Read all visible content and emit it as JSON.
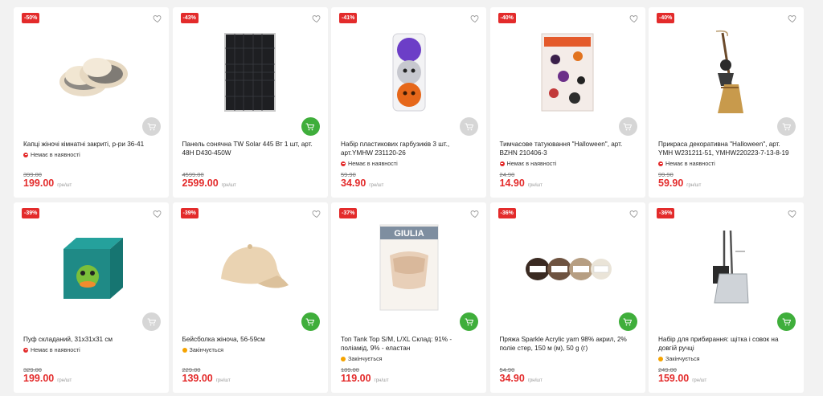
{
  "colors": {
    "badge": "#e32b2b",
    "price": "#e32b2b",
    "cart_active": "#3fae3b",
    "cart_inactive": "#d6d6d6",
    "status_out": "#e32b2b",
    "status_ending": "#f5a300"
  },
  "products": [
    {
      "badge": "-50%",
      "title": "Капці жіночі кімнатні закриті, р-ри 36-41",
      "status": "Немає в наявності",
      "status_type": "out",
      "old_price": "399.00",
      "price": "199.00",
      "currency": "грн/шт",
      "cart_active": false,
      "image": "slippers-image"
    },
    {
      "badge": "-43%",
      "title": "Панель сонячна TW Solar 445 Вт 1 шт, арт. 48H D430-450W",
      "status": "",
      "status_type": "none",
      "old_price": "4599.00",
      "price": "2599.00",
      "currency": "грн/шт",
      "cart_active": true,
      "image": "solar-panel-image"
    },
    {
      "badge": "-41%",
      "title": "Набір пластикових гарбузиків 3 шт., арт.YMHW 231120-26",
      "status": "Немає в наявності",
      "status_type": "out",
      "old_price": "59.90",
      "price": "34.90",
      "currency": "грн/шт",
      "cart_active": false,
      "image": "pumpkins-image"
    },
    {
      "badge": "-40%",
      "title": "Тимчасове татуювання \"Halloween\", арт. BZHN 210406-3",
      "status": "Немає в наявності",
      "status_type": "out",
      "old_price": "24.90",
      "price": "14.90",
      "currency": "грн/шт",
      "cart_active": false,
      "image": "tattoo-image"
    },
    {
      "badge": "-40%",
      "title": "Прикраса декоративна \"Halloween\", арт. YMH W231211-51, YMHW220223-7-13-8-19",
      "status": "Немає в наявності",
      "status_type": "out",
      "old_price": "99.90",
      "price": "59.90",
      "currency": "грн/шт",
      "cart_active": false,
      "image": "witch-broom-image"
    },
    {
      "badge": "-39%",
      "title": "Пуф складаний, 31х31х31 см",
      "status": "Немає в наявності",
      "status_type": "out",
      "old_price": "329.00",
      "price": "199.00",
      "currency": "грн/шт",
      "cart_active": false,
      "image": "pouf-image"
    },
    {
      "badge": "-39%",
      "title": "Бейсболка жіноча, 56-59см",
      "status": "Закінчується",
      "status_type": "ending",
      "old_price": "229.00",
      "price": "139.00",
      "currency": "грн/шт",
      "cart_active": true,
      "image": "cap-image"
    },
    {
      "badge": "-37%",
      "title": "Топ Tank Top S/M, L/XL Склад: 91% - поліамід, 9% - еластан",
      "status": "Закінчується",
      "status_type": "ending",
      "old_price": "189.00",
      "price": "119.00",
      "currency": "грн/шт",
      "cart_active": true,
      "image": "tank-top-image",
      "brand_text": "GIULIA"
    },
    {
      "badge": "-36%",
      "title": "Пряжа Sparkle Acrylic yarn 98% акрил, 2% поліе стер, 150 м (м), 50 g (г)",
      "status": "",
      "status_type": "none",
      "old_price": "54.90",
      "price": "34.90",
      "currency": "грн/шт",
      "cart_active": true,
      "image": "yarn-image"
    },
    {
      "badge": "-36%",
      "title": "Набір для прибирання: щітка і совок на довгій ручці",
      "status": "Закінчується",
      "status_type": "ending",
      "old_price": "249.00",
      "price": "159.00",
      "currency": "грн/шт",
      "cart_active": true,
      "image": "broom-dustpan-image"
    }
  ]
}
